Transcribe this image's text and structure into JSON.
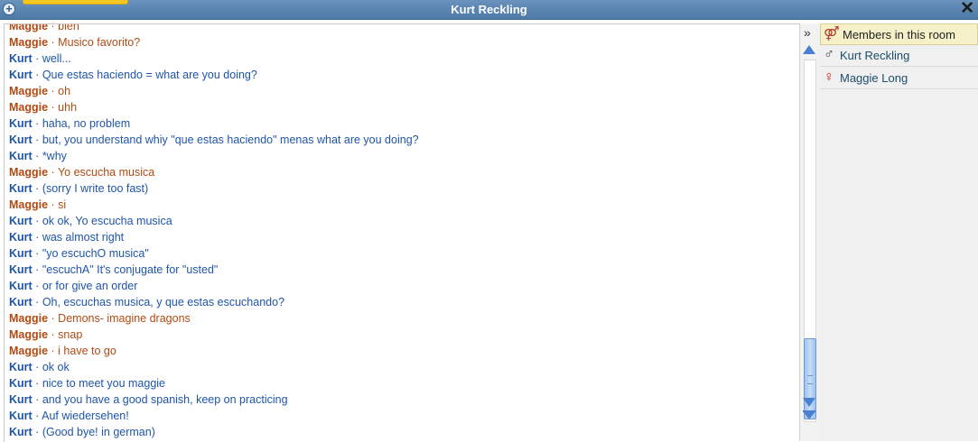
{
  "window": {
    "title": "Kurt Reckling"
  },
  "members": {
    "header": "Members in this room",
    "list": [
      {
        "name": "Kurt Reckling",
        "gender": "male"
      },
      {
        "name": "Maggie Long",
        "gender": "female"
      }
    ]
  },
  "icons": {
    "plus": "+",
    "close": "✕",
    "collapse": "»",
    "male": "♂",
    "female": "♀",
    "members": "⚤"
  },
  "colors": {
    "kurt": "#1f55a8",
    "maggie": "#b14a12",
    "titlebar": "#5a86b2"
  },
  "chat": {
    "separator": " · ",
    "messages": [
      {
        "sender": "Maggie",
        "text": "bien"
      },
      {
        "sender": "Maggie",
        "text": "Musico favorito?"
      },
      {
        "sender": "Kurt",
        "text": "well..."
      },
      {
        "sender": "Kurt",
        "text": "Que estas haciendo = what are you doing?"
      },
      {
        "sender": "Maggie",
        "text": "oh"
      },
      {
        "sender": "Maggie",
        "text": "uhh"
      },
      {
        "sender": "Kurt",
        "text": "haha, no problem"
      },
      {
        "sender": "Kurt",
        "text": "but, you understand whiy \"que estas haciendo\" menas what are you doing?"
      },
      {
        "sender": "Kurt",
        "text": "*why"
      },
      {
        "sender": "Maggie",
        "text": "Yo escucha musica"
      },
      {
        "sender": "Kurt",
        "text": "(sorry I write too fast)"
      },
      {
        "sender": "Maggie",
        "text": "si"
      },
      {
        "sender": "Kurt",
        "text": "ok ok, Yo escucha musica"
      },
      {
        "sender": "Kurt",
        "text": "was almost right"
      },
      {
        "sender": "Kurt",
        "text": "\"yo escuchO musica\""
      },
      {
        "sender": "Kurt",
        "text": "\"escuchA\" It's conjugate for \"usted\""
      },
      {
        "sender": "Kurt",
        "text": "or for give an order"
      },
      {
        "sender": "Kurt",
        "text": "Oh, escuchas musica, y que estas escuchando?"
      },
      {
        "sender": "Maggie",
        "text": "Demons- imagine dragons"
      },
      {
        "sender": "Maggie",
        "text": "snap"
      },
      {
        "sender": "Maggie",
        "text": "i have to go"
      },
      {
        "sender": "Kurt",
        "text": "ok ok"
      },
      {
        "sender": "Kurt",
        "text": "nice to meet you maggie"
      },
      {
        "sender": "Kurt",
        "text": "and you have a good spanish, keep on practicing"
      },
      {
        "sender": "Kurt",
        "text": "Auf wiedersehen!"
      },
      {
        "sender": "Kurt",
        "text": "(Good bye! in german)"
      }
    ]
  }
}
